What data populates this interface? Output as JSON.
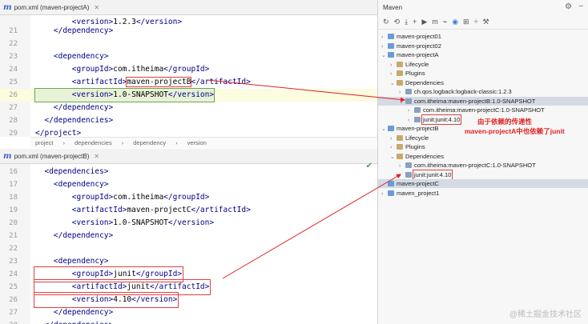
{
  "editorA": {
    "tab": "pom.xml (maven-projectA)",
    "lines": [
      {
        "n": "21",
        "t": "    </dependency>"
      },
      {
        "n": "22",
        "t": ""
      },
      {
        "n": "23",
        "t": "    <dependency>"
      },
      {
        "n": "24",
        "t": "        <groupId>com.itheima</groupId>"
      },
      {
        "n": "25",
        "t": "        <artifactId>maven-projectB</artifactId>"
      },
      {
        "n": "26",
        "t": "        <version>1.0-SNAPSHOT</version>"
      },
      {
        "n": "27",
        "t": "    </dependency>"
      },
      {
        "n": "28",
        "t": "  </dependencies>"
      },
      {
        "n": "29",
        "t": "</project>"
      }
    ],
    "topPartial": "        <version>1.2.3</version>",
    "breadcrumb": [
      "project",
      "dependencies",
      "dependency",
      "version"
    ]
  },
  "editorB": {
    "tab": "pom.xml (maven-projectB)",
    "lines": [
      {
        "n": "16",
        "t": "  <dependencies>"
      },
      {
        "n": "17",
        "t": "    <dependency>"
      },
      {
        "n": "18",
        "t": "        <groupId>com.itheima</groupId>"
      },
      {
        "n": "19",
        "t": "        <artifactId>maven-projectC</artifactId>"
      },
      {
        "n": "20",
        "t": "        <version>1.0-SNAPSHOT</version>"
      },
      {
        "n": "21",
        "t": "    </dependency>"
      },
      {
        "n": "22",
        "t": ""
      },
      {
        "n": "23",
        "t": "    <dependency>"
      },
      {
        "n": "24",
        "t": "        <groupId>junit</groupId>"
      },
      {
        "n": "25",
        "t": "        <artifactId>junit</artifactId>"
      },
      {
        "n": "26",
        "t": "        <version>4.10</version>"
      },
      {
        "n": "27",
        "t": "    </dependency>"
      },
      {
        "n": "28",
        "t": "  </dependencies>"
      }
    ]
  },
  "maven": {
    "title": "Maven",
    "tree": [
      {
        "d": 0,
        "arr": "›",
        "ic": "proj",
        "t": "maven-project01"
      },
      {
        "d": 0,
        "arr": "›",
        "ic": "proj",
        "t": "maven-project02"
      },
      {
        "d": 0,
        "arr": "⌄",
        "ic": "proj",
        "t": "maven-projectA"
      },
      {
        "d": 1,
        "arr": "›",
        "ic": "folder",
        "t": "Lifecycle"
      },
      {
        "d": 1,
        "arr": "›",
        "ic": "folder",
        "t": "Plugins"
      },
      {
        "d": 1,
        "arr": "⌄",
        "ic": "folder",
        "t": "Dependencies"
      },
      {
        "d": 2,
        "arr": "›",
        "ic": "dep",
        "t": "ch.qos.logback:logback-classic:1.2.3"
      },
      {
        "d": 2,
        "arr": "⌄",
        "ic": "dep",
        "t": "com.itheima:maven-projectB:1.0-SNAPSHOT",
        "box": "sel"
      },
      {
        "d": 3,
        "arr": "›",
        "ic": "dep",
        "t": "com.itheima:maven-projectC:1.0-SNAPSHOT"
      },
      {
        "d": 3,
        "arr": "›",
        "ic": "dep",
        "t": "junit:junit:4.10",
        "box": "red"
      },
      {
        "d": 0,
        "arr": "⌄",
        "ic": "proj",
        "t": "maven-projectB"
      },
      {
        "d": 1,
        "arr": "›",
        "ic": "folder",
        "t": "Lifecycle"
      },
      {
        "d": 1,
        "arr": "›",
        "ic": "folder",
        "t": "Plugins"
      },
      {
        "d": 1,
        "arr": "⌄",
        "ic": "folder",
        "t": "Dependencies"
      },
      {
        "d": 2,
        "arr": "›",
        "ic": "dep",
        "t": "com.itheima:maven-projectC:1.0-SNAPSHOT"
      },
      {
        "d": 2,
        "arr": "›",
        "ic": "dep",
        "t": "junit:junit:4.10",
        "box": "red"
      },
      {
        "d": 0,
        "arr": "",
        "ic": "proj",
        "t": "maven-projectC",
        "box": "sel"
      },
      {
        "d": 0,
        "arr": "›",
        "ic": "proj",
        "t": "maven_project1"
      }
    ]
  },
  "annotation": {
    "line1": "由于依赖的传递性",
    "line2": "maven-projectA中也依赖了junit"
  },
  "watermark": "@稀土掘金技术社区"
}
